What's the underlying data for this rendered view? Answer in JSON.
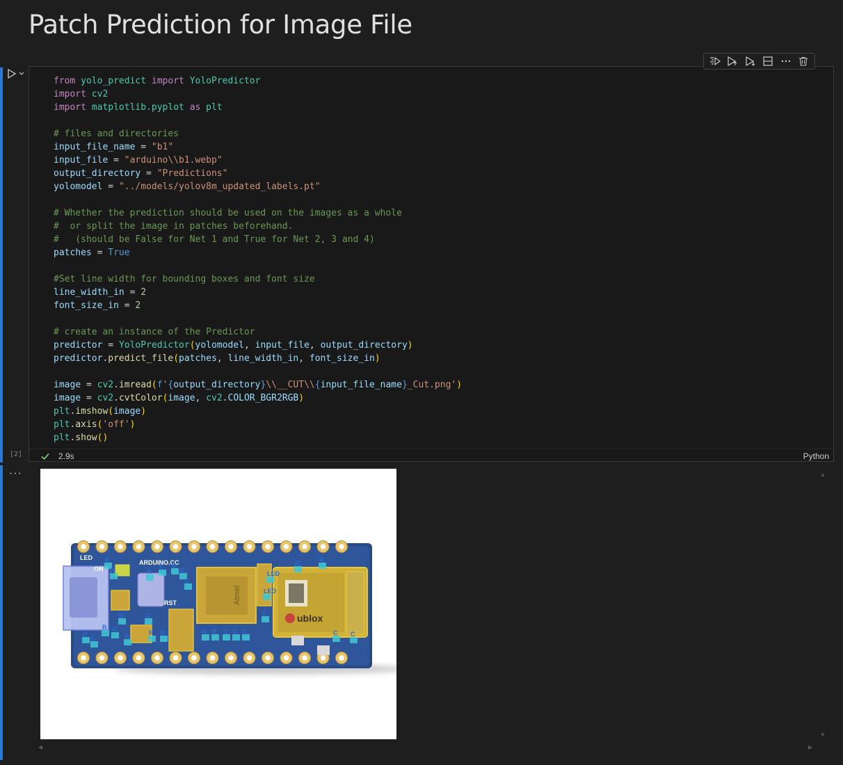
{
  "heading": "Patch Prediction for Image File",
  "cell": {
    "execution_count": "[2]",
    "exec_time": "2.9s",
    "language": "Python",
    "toolbar": [
      {
        "name": "run-by-line-button",
        "icon": "run-by-line-icon"
      },
      {
        "name": "execute-above-button",
        "icon": "execute-above-icon"
      },
      {
        "name": "execute-below-button",
        "icon": "execute-below-icon"
      },
      {
        "name": "split-cell-button",
        "icon": "split-cell-icon"
      },
      {
        "name": "more-actions-button",
        "icon": "more-icon"
      },
      {
        "name": "delete-cell-button",
        "icon": "trash-icon"
      }
    ],
    "code": [
      [
        [
          "kw",
          "from"
        ],
        [
          " ",
          ""
        ],
        [
          "mod",
          "yolo_predict"
        ],
        [
          " ",
          ""
        ],
        [
          "kw",
          "import"
        ],
        [
          " ",
          ""
        ],
        [
          "mod",
          "YoloPredictor"
        ]
      ],
      [
        [
          "kw",
          "import"
        ],
        [
          " ",
          ""
        ],
        [
          "mod",
          "cv2"
        ]
      ],
      [
        [
          "kw",
          "import"
        ],
        [
          " ",
          ""
        ],
        [
          "mod",
          "matplotlib.pyplot"
        ],
        [
          " ",
          ""
        ],
        [
          "kw",
          "as"
        ],
        [
          " ",
          ""
        ],
        [
          "mod",
          "plt"
        ]
      ],
      [],
      [
        [
          "com",
          "# files and directories"
        ]
      ],
      [
        [
          "var",
          "input_file_name"
        ],
        [
          "plain",
          " = "
        ],
        [
          "str",
          "\"b1\""
        ]
      ],
      [
        [
          "var",
          "input_file"
        ],
        [
          "plain",
          " = "
        ],
        [
          "str",
          "\"arduino\\\\b1.webp\""
        ]
      ],
      [
        [
          "var",
          "output_directory"
        ],
        [
          "plain",
          " = "
        ],
        [
          "str",
          "\"Predictions\""
        ]
      ],
      [
        [
          "var",
          "yolomodel"
        ],
        [
          "plain",
          " = "
        ],
        [
          "str",
          "\"../models/yolov8m_updated_labels.pt\""
        ]
      ],
      [],
      [
        [
          "com",
          "# Whether the prediction should be used on the images as a whole"
        ]
      ],
      [
        [
          "com",
          "#  or split the image in patches beforehand."
        ]
      ],
      [
        [
          "com",
          "#   (should be False for Net 1 and True for Net 2, 3 and 4)"
        ]
      ],
      [
        [
          "var",
          "patches"
        ],
        [
          "plain",
          " = "
        ],
        [
          "const",
          "True"
        ]
      ],
      [],
      [
        [
          "com",
          "#Set line width for bounding boxes and font size"
        ]
      ],
      [
        [
          "var",
          "line_width_in"
        ],
        [
          "plain",
          " = "
        ],
        [
          "num",
          "2"
        ]
      ],
      [
        [
          "var",
          "font_size_in"
        ],
        [
          "plain",
          " = "
        ],
        [
          "num",
          "2"
        ]
      ],
      [],
      [
        [
          "com",
          "# create an instance of the Predictor"
        ]
      ],
      [
        [
          "var",
          "predictor"
        ],
        [
          "plain",
          " = "
        ],
        [
          "mod",
          "YoloPredictor"
        ],
        [
          "p1",
          "("
        ],
        [
          "var",
          "yolomodel"
        ],
        [
          "plain",
          ", "
        ],
        [
          "var",
          "input_file"
        ],
        [
          "plain",
          ", "
        ],
        [
          "var",
          "output_directory"
        ],
        [
          "p1",
          ")"
        ]
      ],
      [
        [
          "var",
          "predictor"
        ],
        [
          "plain",
          "."
        ],
        [
          "fn",
          "predict_file"
        ],
        [
          "p1",
          "("
        ],
        [
          "var",
          "patches"
        ],
        [
          "plain",
          ", "
        ],
        [
          "var",
          "line_width_in"
        ],
        [
          "plain",
          ", "
        ],
        [
          "var",
          "font_size_in"
        ],
        [
          "p1",
          ")"
        ]
      ],
      [],
      [
        [
          "var",
          "image"
        ],
        [
          "plain",
          " = "
        ],
        [
          "mod",
          "cv2"
        ],
        [
          "plain",
          "."
        ],
        [
          "fn",
          "imread"
        ],
        [
          "p1",
          "("
        ],
        [
          "const",
          "f"
        ],
        [
          "str",
          "'"
        ],
        [
          "const",
          "{"
        ],
        [
          "var",
          "output_directory"
        ],
        [
          "const",
          "}"
        ],
        [
          "str",
          "\\\\__CUT\\\\"
        ],
        [
          "const",
          "{"
        ],
        [
          "var",
          "input_file_name"
        ],
        [
          "const",
          "}"
        ],
        [
          "str",
          "_Cut.png'"
        ],
        [
          "p1",
          ")"
        ]
      ],
      [
        [
          "var",
          "image"
        ],
        [
          "plain",
          " = "
        ],
        [
          "mod",
          "cv2"
        ],
        [
          "plain",
          "."
        ],
        [
          "fn",
          "cvtColor"
        ],
        [
          "p1",
          "("
        ],
        [
          "var",
          "image"
        ],
        [
          "plain",
          ", "
        ],
        [
          "mod",
          "cv2"
        ],
        [
          "plain",
          "."
        ],
        [
          "var",
          "COLOR_BGR2RGB"
        ],
        [
          "p1",
          ")"
        ]
      ],
      [
        [
          "mod",
          "plt"
        ],
        [
          "plain",
          "."
        ],
        [
          "fn",
          "imshow"
        ],
        [
          "p1",
          "("
        ],
        [
          "var",
          "image"
        ],
        [
          "p1",
          ")"
        ]
      ],
      [
        [
          "mod",
          "plt"
        ],
        [
          "plain",
          "."
        ],
        [
          "fn",
          "axis"
        ],
        [
          "p1",
          "("
        ],
        [
          "str",
          "'off'"
        ],
        [
          "p1",
          ")"
        ]
      ],
      [
        [
          "mod",
          "plt"
        ],
        [
          "plain",
          "."
        ],
        [
          "fn",
          "show"
        ],
        [
          "p1",
          "()"
        ]
      ]
    ]
  },
  "output": {
    "more_label": "···",
    "board_labels": [
      "ARDUINO.CC",
      "ON",
      "LED",
      "RST",
      "ublox",
      "Atmel"
    ],
    "det_labels": [
      "R",
      "R",
      "R",
      "C",
      "C",
      "C",
      "D",
      "C",
      "IC",
      "IC",
      "R",
      "R",
      "R",
      "R",
      "R",
      "C",
      "C",
      "C",
      "C",
      "LED",
      "LED",
      "IC",
      "R",
      "R",
      "R",
      "C",
      "C",
      "C"
    ]
  },
  "colors": {
    "background": "#1e1e1e",
    "editor": "#191919",
    "accent": "#2b79d0",
    "success": "#89d185"
  }
}
